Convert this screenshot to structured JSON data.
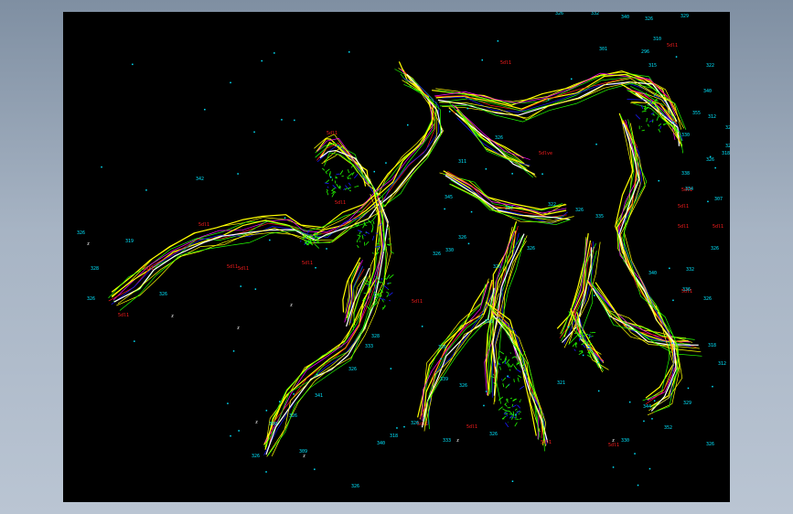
{
  "app": {
    "canvas": "cad-drawing-viewport"
  },
  "colors": {
    "background": "#000000",
    "frame": "#a2afbf",
    "yellow": "#ffff00",
    "green": "#22ff00",
    "magenta": "#ff00ff",
    "red": "#ff1e1e",
    "blue": "#1a1aff",
    "cyan": "#00e5ff",
    "white": "#ffffff"
  },
  "red_labels": [
    "5dl1",
    "5dl1",
    "5dl1",
    "5dl1",
    "5dl1",
    "5dl1",
    "5dl1",
    "5dl1",
    "5dl1",
    "5dl1",
    "5dl1",
    "5dl1",
    "5dl1",
    "5dl1",
    "5dl1",
    "5dl1",
    "5dlve",
    "5dl1",
    "5dl1",
    "5dl1",
    "5dl1"
  ],
  "cyan_labels": [
    "326",
    "332",
    "340",
    "326",
    "329",
    "310",
    "301",
    "296",
    "315",
    "322",
    "340",
    "355",
    "312",
    "326",
    "330",
    "326",
    "338",
    "334",
    "326",
    "318",
    "307",
    "326",
    "332",
    "340",
    "336",
    "326",
    "318",
    "312",
    "329",
    "344",
    "352",
    "326",
    "330",
    "321",
    "326",
    "333",
    "326",
    "318",
    "340",
    "326",
    "309",
    "326",
    "300",
    "326",
    "341",
    "326",
    "333",
    "328",
    "326",
    "339",
    "326",
    "316",
    "326",
    "345",
    "326",
    "330",
    "326",
    "311",
    "326",
    "337",
    "326",
    "322",
    "326",
    "335",
    "326",
    "328",
    "326",
    "319",
    "326",
    "342"
  ],
  "white_labels": [
    "z",
    "z",
    "z",
    "z",
    "z",
    "z",
    "z",
    "z"
  ]
}
